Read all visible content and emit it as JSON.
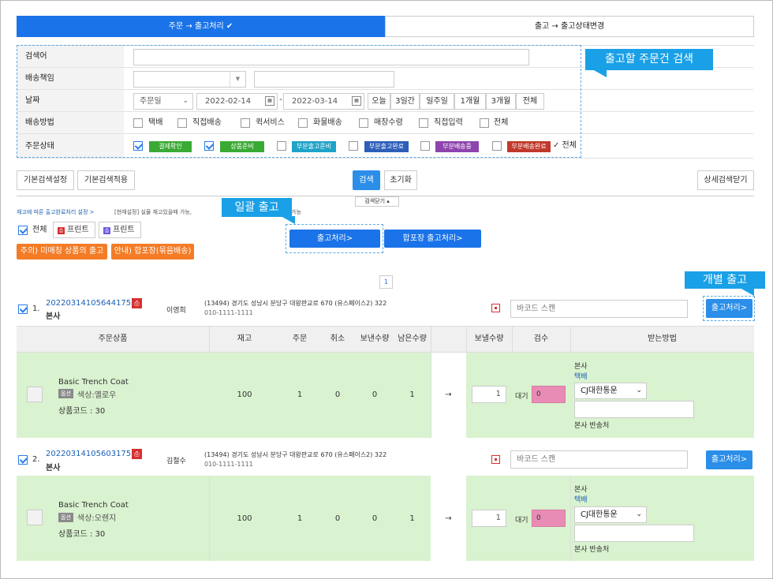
{
  "tabs": {
    "active": "주문 → 출고처리 ✔",
    "second": "출고 → 출고상태변경"
  },
  "filter": {
    "search_label": "검색어",
    "delivery_label": "배송책임",
    "date_label": "날짜",
    "date_type": "주문일",
    "date_from": "2022-02-14",
    "date_to": "2022-03-14",
    "date_sep": "-",
    "quick_dates": [
      "오늘",
      "3일간",
      "일주일",
      "1개월",
      "3개월",
      "전체"
    ],
    "method_label": "배송방법",
    "methods": [
      "택배",
      "직접배송",
      "퀵서비스",
      "화물배송",
      "매장수령",
      "직접입력",
      "전체"
    ],
    "status_label": "주문상태",
    "statuses": [
      {
        "label": "결제확인",
        "color": "#3aaa35",
        "checked": true
      },
      {
        "label": "상품준비",
        "color": "#3aaa35",
        "checked": true
      },
      {
        "label": "부분출고준비",
        "color": "#1fa3c8",
        "checked": false
      },
      {
        "label": "부분출고완료",
        "color": "#2d5fb8",
        "checked": false
      },
      {
        "label": "부분배송중",
        "color": "#8e44ad",
        "checked": false
      },
      {
        "label": "부분배송완료",
        "color": "#c0392b",
        "checked": false
      }
    ],
    "status_all": "✓ 전체"
  },
  "callouts": {
    "search": "출고할 주문건 검색",
    "bulk": "일괄 출고",
    "single": "개별 출고"
  },
  "toolbar": {
    "default_setting": "기본검색설정",
    "default_apply": "기본검색적용",
    "search": "검색",
    "reset": "초기화",
    "close_detail": "상세검색닫기",
    "close_search": "검색닫기 ▴"
  },
  "notice": {
    "link": "재고에 따른 출고완료처리 설정 >",
    "text": "[현재설정] 실물 재고있을때 가능,",
    "tail": "가능"
  },
  "bulk": {
    "all": "전체",
    "print1": "프린트",
    "print2": "프린트",
    "ship": "출고처리>",
    "merge_ship": "합포장 출고처리>",
    "warn1": "주의) 미매칭 상품의 출고",
    "warn2": "안내) 합포장(묶음배송)"
  },
  "page": "1",
  "table_headers": {
    "product": "주문상품",
    "stock": "재고",
    "order": "주문",
    "cancel": "취소",
    "sent": "보낸수량",
    "remain": "남은수량",
    "send_qty": "보낼수량",
    "inspect": "검수",
    "receive": "받는방법"
  },
  "orders": [
    {
      "no": "1.",
      "order_id": "2022031410564417533",
      "branch": "본사",
      "name": "이영희",
      "address": "(13494) 경기도 성남시 분당구 대왕판교로 670 (유스페이스2) 322",
      "phone": "010-1111-1111",
      "barcode_placeholder": "바코드 스캔",
      "ship_btn": "출고처리>",
      "product": "Basic Trench Coat",
      "tag": "옵션",
      "option": "색상:옐로우",
      "code": "상품코드 : 30",
      "stock": "100",
      "order": "1",
      "cancel": "0",
      "sent": "0",
      "remain": "1",
      "arrow": "→",
      "send_qty": "1",
      "wait": "대기",
      "inspect": "0",
      "recv_branch": "본사",
      "recv_method": "택배",
      "courier": "CJ대한통운",
      "return": "본사 반송처"
    },
    {
      "no": "2.",
      "order_id": "2022031410560317532",
      "branch": "본사",
      "name": "김철수",
      "address": "(13494) 경기도 성남시 분당구 대왕판교로 670 (유스페이스2) 322",
      "phone": "010-1111-1111",
      "barcode_placeholder": "바코드 스캔",
      "ship_btn": "출고처리>",
      "product": "Basic Trench Coat",
      "tag": "옵션",
      "option": "색상:오렌지",
      "code": "상품코드 : 30",
      "stock": "100",
      "order": "1",
      "cancel": "0",
      "sent": "0",
      "remain": "1",
      "arrow": "→",
      "send_qty": "1",
      "wait": "대기",
      "inspect": "0",
      "recv_branch": "본사",
      "recv_method": "택배",
      "courier": "CJ대한통운",
      "return": "본사 반송처"
    }
  ]
}
